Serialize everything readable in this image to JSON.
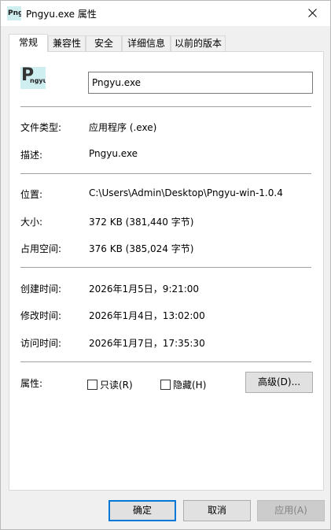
{
  "window": {
    "title": "Pngyu.exe 属性",
    "icon_text": "Pngyu"
  },
  "tabs": [
    {
      "label": "常规",
      "active": true
    },
    {
      "label": "兼容性",
      "active": false
    },
    {
      "label": "安全",
      "active": false
    },
    {
      "label": "详细信息",
      "active": false
    },
    {
      "label": "以前的版本",
      "active": false
    }
  ],
  "file": {
    "icon_text_big": "P",
    "icon_text_small": "ngyu",
    "name": "Pngyu.exe"
  },
  "properties": {
    "type_label": "文件类型:",
    "type_value": "应用程序 (.exe)",
    "desc_label": "描述:",
    "desc_value": "Pngyu.exe",
    "location_label": "位置:",
    "location_value": "C:\\Users\\Admin\\Desktop\\Pngyu-win-1.0.4",
    "size_label": "大小:",
    "size_value": "372 KB (381,440 字节)",
    "disk_label": "占用空间:",
    "disk_value": "376 KB (385,024 字节)",
    "created_label": "创建时间:",
    "created_value": "2026年1月5日，9:21:00",
    "modified_label": "修改时间:",
    "modified_value": "2026年1月4日，13:02:00",
    "accessed_label": "访问时间:",
    "accessed_value": "2026年1月7日，17:35:30",
    "attributes_label": "属性:",
    "readonly_label": "只读(R)",
    "hidden_label": "隐藏(H)",
    "advanced_label": "高级(D)..."
  },
  "buttons": {
    "ok": "确定",
    "cancel": "取消",
    "apply": "应用(A)"
  },
  "colors": {
    "accent": "#0078d7",
    "icon_bg": "#cfeef0"
  }
}
